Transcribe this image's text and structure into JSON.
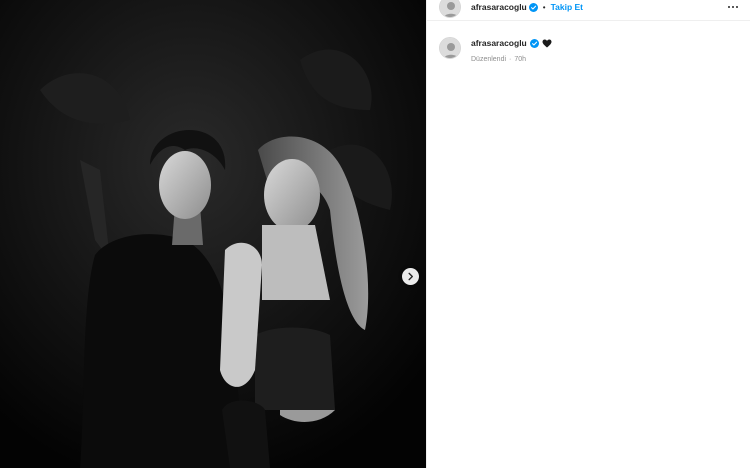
{
  "header": {
    "username": "afrasaracoglu",
    "follow_label": "Takip Et",
    "separator": "•"
  },
  "caption": {
    "username": "afrasaracoglu",
    "text_emoji": "heart-black-emoji",
    "edited_label": "Düzenlendi",
    "separator": "·",
    "time": "70h"
  },
  "colors": {
    "accent": "#0095f6",
    "verified": "#0095f6",
    "text": "#262626",
    "muted": "#8e8e8e"
  },
  "icons": {
    "verified": "verified-badge-icon",
    "more": "more-options-icon",
    "next": "chevron-right-icon"
  }
}
